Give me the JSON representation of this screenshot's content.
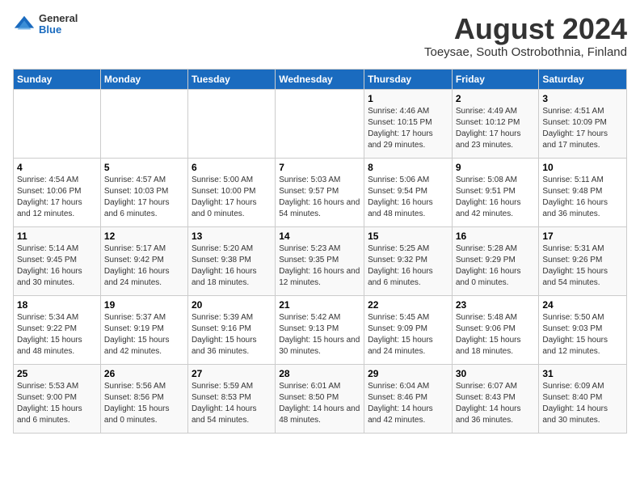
{
  "logo": {
    "general": "General",
    "blue": "Blue"
  },
  "header": {
    "month_year": "August 2024",
    "location": "Toeysae, South Ostrobothnia, Finland"
  },
  "days_of_week": [
    "Sunday",
    "Monday",
    "Tuesday",
    "Wednesday",
    "Thursday",
    "Friday",
    "Saturday"
  ],
  "weeks": [
    [
      {
        "day": "",
        "content": ""
      },
      {
        "day": "",
        "content": ""
      },
      {
        "day": "",
        "content": ""
      },
      {
        "day": "",
        "content": ""
      },
      {
        "day": "1",
        "content": "Sunrise: 4:46 AM\nSunset: 10:15 PM\nDaylight: 17 hours and 29 minutes."
      },
      {
        "day": "2",
        "content": "Sunrise: 4:49 AM\nSunset: 10:12 PM\nDaylight: 17 hours and 23 minutes."
      },
      {
        "day": "3",
        "content": "Sunrise: 4:51 AM\nSunset: 10:09 PM\nDaylight: 17 hours and 17 minutes."
      }
    ],
    [
      {
        "day": "4",
        "content": "Sunrise: 4:54 AM\nSunset: 10:06 PM\nDaylight: 17 hours and 12 minutes."
      },
      {
        "day": "5",
        "content": "Sunrise: 4:57 AM\nSunset: 10:03 PM\nDaylight: 17 hours and 6 minutes."
      },
      {
        "day": "6",
        "content": "Sunrise: 5:00 AM\nSunset: 10:00 PM\nDaylight: 17 hours and 0 minutes."
      },
      {
        "day": "7",
        "content": "Sunrise: 5:03 AM\nSunset: 9:57 PM\nDaylight: 16 hours and 54 minutes."
      },
      {
        "day": "8",
        "content": "Sunrise: 5:06 AM\nSunset: 9:54 PM\nDaylight: 16 hours and 48 minutes."
      },
      {
        "day": "9",
        "content": "Sunrise: 5:08 AM\nSunset: 9:51 PM\nDaylight: 16 hours and 42 minutes."
      },
      {
        "day": "10",
        "content": "Sunrise: 5:11 AM\nSunset: 9:48 PM\nDaylight: 16 hours and 36 minutes."
      }
    ],
    [
      {
        "day": "11",
        "content": "Sunrise: 5:14 AM\nSunset: 9:45 PM\nDaylight: 16 hours and 30 minutes."
      },
      {
        "day": "12",
        "content": "Sunrise: 5:17 AM\nSunset: 9:42 PM\nDaylight: 16 hours and 24 minutes."
      },
      {
        "day": "13",
        "content": "Sunrise: 5:20 AM\nSunset: 9:38 PM\nDaylight: 16 hours and 18 minutes."
      },
      {
        "day": "14",
        "content": "Sunrise: 5:23 AM\nSunset: 9:35 PM\nDaylight: 16 hours and 12 minutes."
      },
      {
        "day": "15",
        "content": "Sunrise: 5:25 AM\nSunset: 9:32 PM\nDaylight: 16 hours and 6 minutes."
      },
      {
        "day": "16",
        "content": "Sunrise: 5:28 AM\nSunset: 9:29 PM\nDaylight: 16 hours and 0 minutes."
      },
      {
        "day": "17",
        "content": "Sunrise: 5:31 AM\nSunset: 9:26 PM\nDaylight: 15 hours and 54 minutes."
      }
    ],
    [
      {
        "day": "18",
        "content": "Sunrise: 5:34 AM\nSunset: 9:22 PM\nDaylight: 15 hours and 48 minutes."
      },
      {
        "day": "19",
        "content": "Sunrise: 5:37 AM\nSunset: 9:19 PM\nDaylight: 15 hours and 42 minutes."
      },
      {
        "day": "20",
        "content": "Sunrise: 5:39 AM\nSunset: 9:16 PM\nDaylight: 15 hours and 36 minutes."
      },
      {
        "day": "21",
        "content": "Sunrise: 5:42 AM\nSunset: 9:13 PM\nDaylight: 15 hours and 30 minutes."
      },
      {
        "day": "22",
        "content": "Sunrise: 5:45 AM\nSunset: 9:09 PM\nDaylight: 15 hours and 24 minutes."
      },
      {
        "day": "23",
        "content": "Sunrise: 5:48 AM\nSunset: 9:06 PM\nDaylight: 15 hours and 18 minutes."
      },
      {
        "day": "24",
        "content": "Sunrise: 5:50 AM\nSunset: 9:03 PM\nDaylight: 15 hours and 12 minutes."
      }
    ],
    [
      {
        "day": "25",
        "content": "Sunrise: 5:53 AM\nSunset: 9:00 PM\nDaylight: 15 hours and 6 minutes."
      },
      {
        "day": "26",
        "content": "Sunrise: 5:56 AM\nSunset: 8:56 PM\nDaylight: 15 hours and 0 minutes."
      },
      {
        "day": "27",
        "content": "Sunrise: 5:59 AM\nSunset: 8:53 PM\nDaylight: 14 hours and 54 minutes."
      },
      {
        "day": "28",
        "content": "Sunrise: 6:01 AM\nSunset: 8:50 PM\nDaylight: 14 hours and 48 minutes."
      },
      {
        "day": "29",
        "content": "Sunrise: 6:04 AM\nSunset: 8:46 PM\nDaylight: 14 hours and 42 minutes."
      },
      {
        "day": "30",
        "content": "Sunrise: 6:07 AM\nSunset: 8:43 PM\nDaylight: 14 hours and 36 minutes."
      },
      {
        "day": "31",
        "content": "Sunrise: 6:09 AM\nSunset: 8:40 PM\nDaylight: 14 hours and 30 minutes."
      }
    ]
  ]
}
